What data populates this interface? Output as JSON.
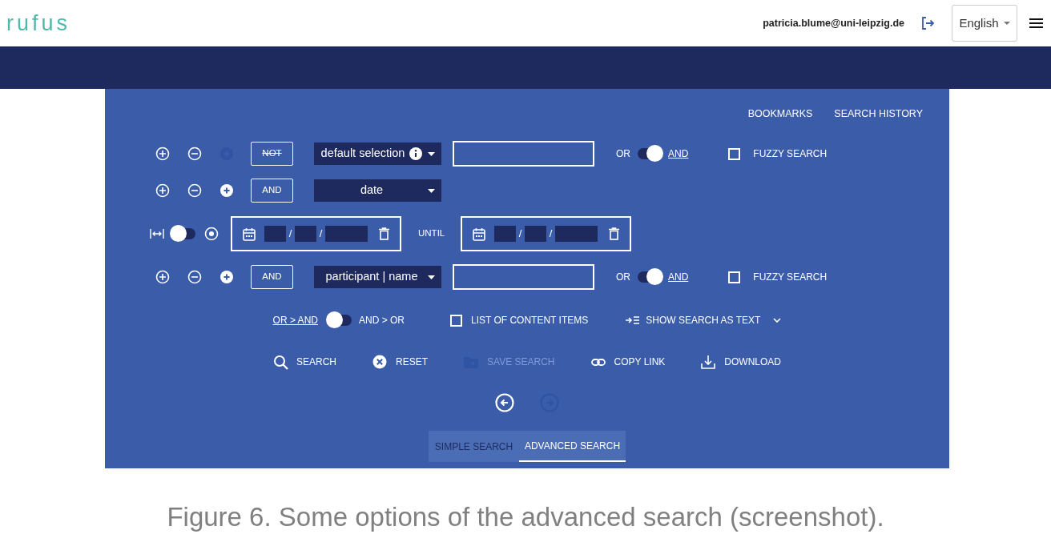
{
  "header": {
    "logo": "rufus",
    "user_email": "patricia.blume@uni-leipzig.de",
    "language": "English"
  },
  "panel_links": [
    "BOOKMARKS",
    "SEARCH HISTORY"
  ],
  "rows": [
    {
      "kind": "criterion",
      "add_enabled": false,
      "operator": {
        "label": "NOT",
        "active": false
      },
      "field": "default selection",
      "info": true,
      "logic": {
        "left": "OR",
        "right": "AND",
        "on": true
      },
      "fuzzy": {
        "label": "FUZZY SEARCH",
        "checked": false
      }
    },
    {
      "kind": "criterion",
      "add_enabled": true,
      "operator": {
        "label": "AND",
        "active": true
      },
      "field": "date",
      "info": false
    },
    {
      "kind": "date_range",
      "range_on": false,
      "separator": "/",
      "until": "UNTIL"
    },
    {
      "kind": "criterion",
      "add_enabled": true,
      "operator": {
        "label": "AND",
        "active": true
      },
      "field": "participant | name",
      "info": false,
      "logic": {
        "left": "OR",
        "right": "AND",
        "on": true
      },
      "fuzzy": {
        "label": "FUZZY SEARCH",
        "checked": false
      }
    }
  ],
  "options": {
    "group_toggle": {
      "left": "OR > AND",
      "right": "AND > OR",
      "on": false
    },
    "content_items": {
      "label": "LIST OF CONTENT ITEMS",
      "checked": false
    },
    "show_text": "SHOW SEARCH AS TEXT"
  },
  "actions": [
    {
      "kind": "search",
      "label": "SEARCH",
      "disabled": false
    },
    {
      "kind": "reset",
      "label": "RESET",
      "disabled": false
    },
    {
      "kind": "save",
      "label": "SAVE SEARCH",
      "disabled": true
    },
    {
      "kind": "link",
      "label": "COPY LINK",
      "disabled": false
    },
    {
      "kind": "download",
      "label": "DOWNLOAD",
      "disabled": false
    }
  ],
  "navigation": {
    "back_enabled": true,
    "forward_enabled": false
  },
  "tabs": [
    {
      "label": "SIMPLE SEARCH",
      "selected": false
    },
    {
      "label": "ADVANCED SEARCH",
      "selected": true
    }
  ],
  "caption": "Figure 6. Some options of the advanced search (screenshot)."
}
